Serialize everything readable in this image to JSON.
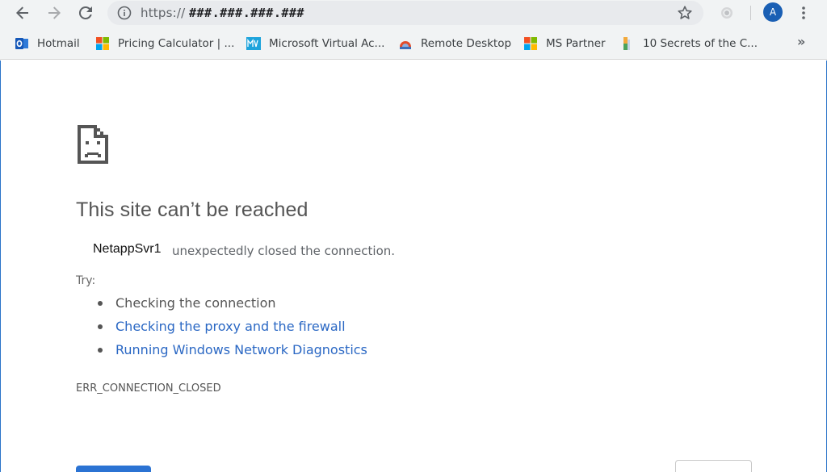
{
  "toolbar": {
    "url_scheme": "https://",
    "url_host": "###.###.###.###",
    "avatar_letter": "A",
    "overflow_label": "»"
  },
  "bookmarks": [
    {
      "label": "Hotmail",
      "icon": "outlook-icon"
    },
    {
      "label": "Pricing Calculator | ...",
      "icon": "microsoft-icon"
    },
    {
      "label": "Microsoft Virtual Ac...",
      "icon": "mva-icon"
    },
    {
      "label": "Remote Desktop",
      "icon": "remote-desktop-icon"
    },
    {
      "label": "MS Partner",
      "icon": "microsoft-icon"
    },
    {
      "label": "10 Secrets of the C...",
      "icon": "bookmark-page-icon"
    }
  ],
  "error": {
    "title": "This site can’t be reached",
    "host": "NetappSvr1",
    "reason": "unexpectedly closed the connection.",
    "try_label": "Try:",
    "suggestions": [
      {
        "text": "Checking the connection"
      },
      {
        "text": "Checking the proxy and the firewall"
      },
      {
        "text": "Running Windows Network Diagnostics"
      }
    ],
    "code": "ERR_CONNECTION_CLOSED"
  },
  "colors": {
    "accent": "#2b73d3",
    "link": "#2b68c4",
    "toolbar_bg": "#f1f3f4"
  }
}
